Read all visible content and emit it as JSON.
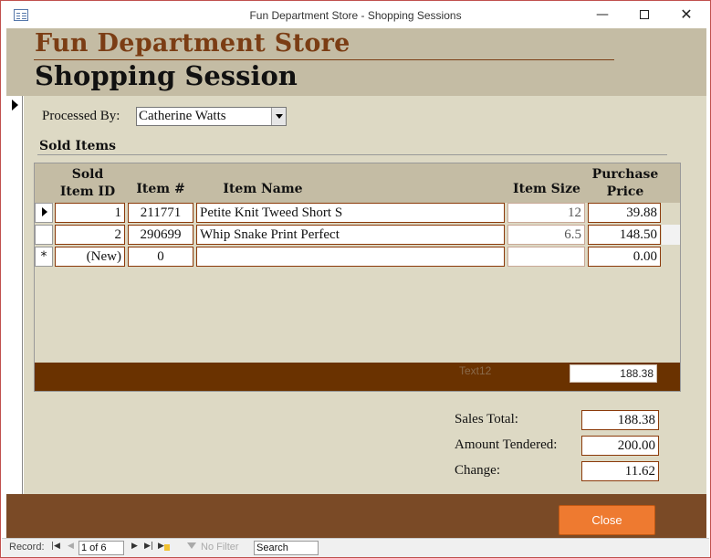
{
  "window": {
    "title": "Fun Department Store - Shopping Sessions",
    "minimize_glyph": "—",
    "close_glyph": "✕"
  },
  "header": {
    "store_name": "Fun Department Store",
    "page_title": "Shopping Session"
  },
  "form": {
    "processed_by_label": "Processed By:",
    "processed_by_value": "Catherine Watts",
    "sold_items_title": "Sold Items"
  },
  "subform": {
    "columns": {
      "sold_item_id_line1": "Sold",
      "sold_item_id_line2": "Item ID",
      "item_number": "Item #",
      "item_name": "Item Name",
      "item_size": "Item Size",
      "purchase_price_line1": "Purchase",
      "purchase_price_line2": "Price"
    },
    "rows": [
      {
        "sold_item_id": "1",
        "item_number": "211771",
        "item_name": "Petite Knit Tweed Short S",
        "item_size": "12",
        "purchase_price": "39.88"
      },
      {
        "sold_item_id": "2",
        "item_number": "290699",
        "item_name": "Whip Snake Print Perfect",
        "item_size": "6.5",
        "purchase_price": "148.50"
      }
    ],
    "new_row": {
      "marker": "*",
      "sold_item_id": "(New)",
      "item_number": "0",
      "item_name": "",
      "item_size": "",
      "purchase_price": "0.00"
    },
    "footer_label": "Text12",
    "footer_total": "188.38"
  },
  "totals": {
    "sales_total_label": "Sales Total:",
    "sales_total_value": "188.38",
    "amount_tendered_label": "Amount Tendered:",
    "amount_tendered_value": "200.00",
    "change_label": "Change:",
    "change_value": "11.62"
  },
  "footer": {
    "close_label": "Close"
  },
  "navigation": {
    "record_label": "Record:",
    "first_glyph": "|◀",
    "prev_glyph": "◀",
    "position": "1 of 6",
    "next_glyph": "▶",
    "last_glyph": "▶|",
    "new_glyph": "▶",
    "no_filter_label": "No Filter",
    "search_value": "Search"
  },
  "colors": {
    "header_band": "#c4bca4",
    "form_background": "#ddd9c4",
    "store_name": "#7b3d14",
    "subform_footer": "#6a3200",
    "footer_band": "#7a4a26",
    "close_button": "#ee7a30"
  }
}
